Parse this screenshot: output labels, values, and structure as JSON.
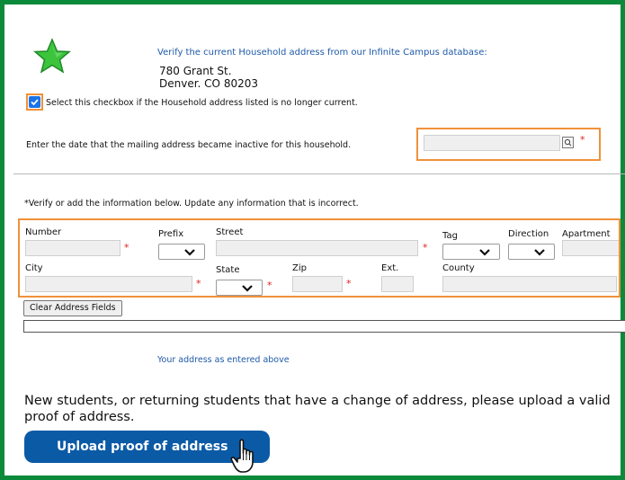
{
  "household": {
    "verify_title": "Verify the current Household address from our Infinite Campus database:",
    "address_line1": "780 Grant St.",
    "address_line2": "Denver. CO 80203"
  },
  "inactive_checkbox": {
    "checked": true,
    "label": "Select this checkbox if the Household address listed is no longer current."
  },
  "inactive_date": {
    "label": "Enter the date that the mailing address became inactive for this household.",
    "value": "",
    "required_marker": "*"
  },
  "verify_add_note": "*Verify or add the information below. Update any information that is incorrect.",
  "address_fields": {
    "number": "Number",
    "prefix": "Prefix",
    "street": "Street",
    "tag": "Tag",
    "direction": "Direction",
    "apartment": "Apartment",
    "city": "City",
    "state": "State",
    "zip": "Zip",
    "ext": "Ext.",
    "county": "County",
    "required_marker": "*"
  },
  "clear_button": "Clear Address Fields",
  "your_address_label": "Your address as entered above",
  "proof_note": "New students, or returning students that have a change of address, please upload a valid proof of address.",
  "upload_button": "Upload proof of address",
  "colors": {
    "frame": "#0a8a3a",
    "highlight": "#f0913a",
    "link_blue": "#1e5aa8",
    "button_blue": "#0b5aa6",
    "required_red": "#d22222"
  },
  "icons": {
    "star": "star-icon",
    "calendar": "calendar-icon",
    "dropdown": "chevron-down-icon",
    "cursor": "pointing-hand-cursor-icon"
  }
}
